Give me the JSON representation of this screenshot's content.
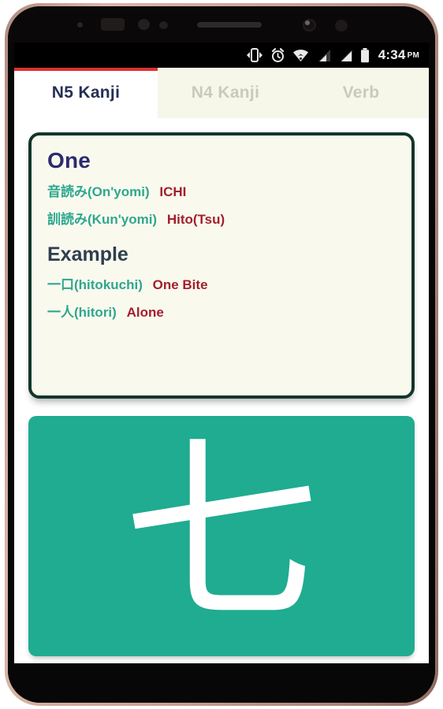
{
  "statusbar": {
    "icons": [
      "rotation-lock-icon",
      "alarm-clock-icon",
      "wifi-icon",
      "signal-sim1-icon",
      "signal-sim2-icon",
      "battery-icon"
    ],
    "time": "4:34",
    "ampm": "PM"
  },
  "tabs": [
    {
      "label": "N5 Kanji",
      "active": true
    },
    {
      "label": "N4 Kanji",
      "active": false
    },
    {
      "label": "Verb",
      "active": false
    }
  ],
  "info_card": {
    "title": "One",
    "readings": [
      {
        "label": "音読み(On'yomi)",
        "value": "ICHI"
      },
      {
        "label": "訓読み(Kun'yomi)",
        "value": "Hito(Tsu)"
      }
    ],
    "example_heading": "Example",
    "examples": [
      {
        "term": "一口(hitokuchi)",
        "meaning": "One Bite"
      },
      {
        "term": "一人(hitori)",
        "meaning": "Alone"
      }
    ]
  },
  "kanji_card": {
    "glyph": "七"
  },
  "colors": {
    "accent_teal": "#1fac91",
    "card_bg": "#f9f9ee",
    "card_border": "#12362a",
    "tab_bg": "#f6f6e9",
    "tab_active_indicator": "#e03030",
    "tab_active_text": "#262f56",
    "tab_inactive_text": "#c9c9bc",
    "title_blue": "#2b2b70",
    "reading_teal": "#2fa78f",
    "meaning_red": "#a21f2c",
    "example_heading": "#2f3e50"
  }
}
